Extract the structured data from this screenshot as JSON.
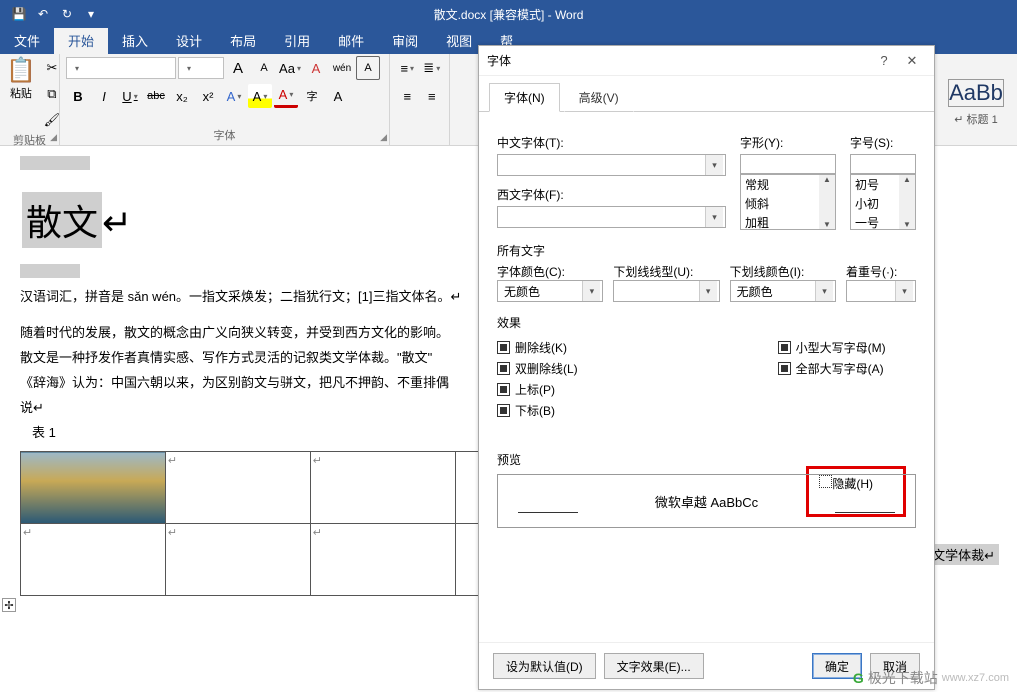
{
  "titlebar": {
    "app": "散文.docx [兼容模式] - Word"
  },
  "menu": {
    "file": "文件",
    "tabs": [
      "开始",
      "插入",
      "设计",
      "布局",
      "引用",
      "邮件",
      "审阅",
      "视图",
      "帮"
    ]
  },
  "ribbon": {
    "clipboard": {
      "paste": "粘贴",
      "label": "剪贴板"
    },
    "font": {
      "name": "",
      "size": "",
      "grow": "A",
      "shrink": "A",
      "case": "Aa",
      "clear": "A",
      "phonetic": "wén",
      "charborder": "A",
      "bold": "B",
      "italic": "I",
      "underline": "U",
      "strike": "abc",
      "sub": "x₂",
      "sup": "x²",
      "texteffect": "A",
      "highlight": "A",
      "fontcolor": "A",
      "enclosed": "字",
      "kern": "A",
      "label": "字体"
    }
  },
  "styles": {
    "preview": "AaBb",
    "name": "↵ 标题 1"
  },
  "doc": {
    "title": "散文",
    "p1": "汉语词汇，拼音是 sǎn wén。一指文采焕发；二指犹行文；[1]三指文体名。↵",
    "p2": "随着时代的发展，散文的概念由广义向狭义转变，并受到西方文化的影响。",
    "p3": "散文是一种抒发作者真情实感、写作方式灵活的记叙类文学体裁。\"散文\"",
    "p4": "《辞海》认为：中国六朝以来，为区别韵文与骈文，把凡不押韵、不重排偶",
    "p5": "说↵",
    "table_label": "表 1",
    "side": "文学体裁↵"
  },
  "dialog": {
    "title": "字体",
    "tab_font": "字体(N)",
    "tab_adv": "高级(V)",
    "lbl_cnfont": "中文字体(T):",
    "lbl_enfont": "西文字体(F):",
    "lbl_style": "字形(Y):",
    "lbl_size": "字号(S):",
    "style_items": [
      "常规",
      "倾斜",
      "加粗"
    ],
    "size_items": [
      "初号",
      "小初",
      "一号"
    ],
    "lbl_all": "所有文字",
    "lbl_fontcolor": "字体颜色(C):",
    "lbl_ultype": "下划线线型(U):",
    "lbl_ulcolor": "下划线颜色(I):",
    "lbl_emph": "着重号(·):",
    "val_nocolor": "无颜色",
    "lbl_effects": "效果",
    "chk_strike": "删除线(K)",
    "chk_dstrike": "双删除线(L)",
    "chk_super": "上标(P)",
    "chk_sub": "下标(B)",
    "chk_smallcap": "小型大写字母(M)",
    "chk_allcap": "全部大写字母(A)",
    "chk_hidden": "隐藏(H)",
    "lbl_preview": "预览",
    "preview_text": "微软卓越  AaBbCc",
    "btn_default": "设为默认值(D)",
    "btn_texteffect": "文字效果(E)...",
    "btn_ok": "确定",
    "btn_cancel": "取消"
  },
  "watermark": {
    "text": "极光下载站",
    "url": "www.xz7.com"
  }
}
